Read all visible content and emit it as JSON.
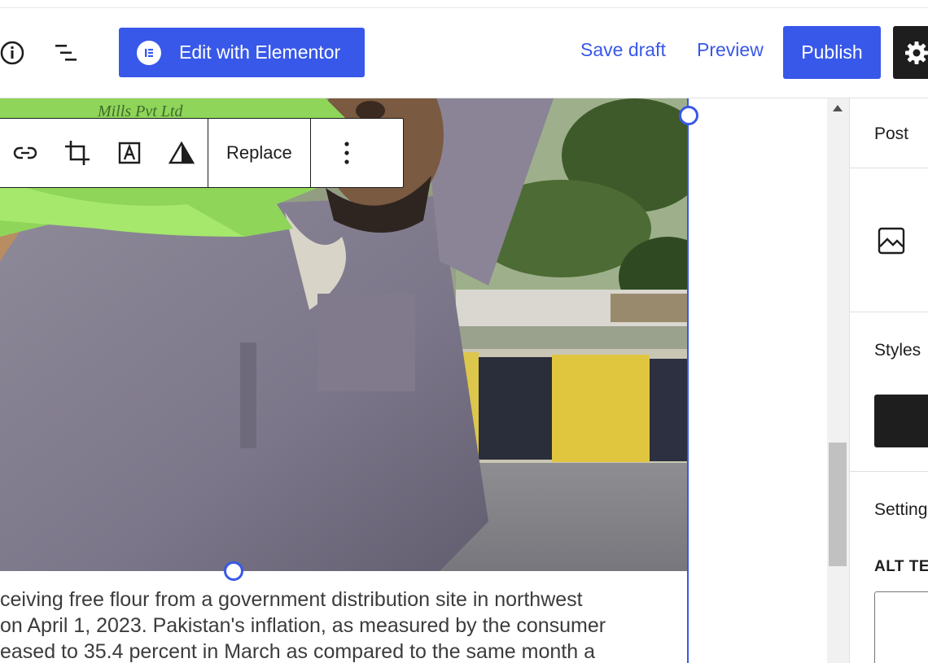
{
  "header": {
    "elementor_label": "Edit with Elementor",
    "save_draft_label": "Save draft",
    "preview_label": "Preview",
    "publish_label": "Publish"
  },
  "icons": {
    "info": "info-icon",
    "outline": "document-outline-icon",
    "elementor": "elementor-icon",
    "settings": "gear-icon",
    "link": "link-icon",
    "crop": "crop-icon",
    "text_overlay": "text-overlay-icon",
    "duotone": "duotone-icon",
    "more": "more-vertical-icon",
    "image": "image-icon"
  },
  "block_toolbar": {
    "replace_label": "Replace"
  },
  "caption": {
    "lines": [
      "ceiving free flour from a government distribution site in northwest",
      "on April 1, 2023. Pakistan's inflation, as measured by the consumer",
      "eased to 35.4 percent in March as compared to the same month a"
    ]
  },
  "sidebar": {
    "tab_post": "Post",
    "styles_label": "Styles",
    "settings_label": "Settings",
    "alt_text_label": "ALT TEXT"
  },
  "colors": {
    "accent": "#3858e9",
    "dark": "#1e1e1e",
    "scrollbar_track": "#f1f1f1",
    "scrollbar_thumb": "#c1c1c1"
  }
}
